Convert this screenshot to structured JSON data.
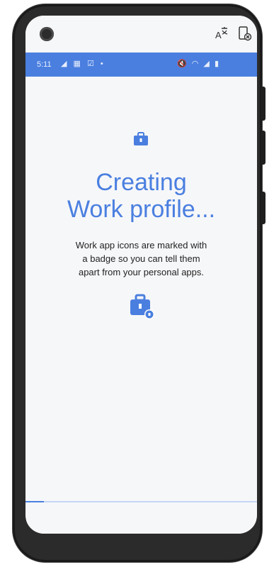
{
  "status_bar": {
    "time": "5:11",
    "left_icons": "◢ ▦ ☑ •",
    "right_icons": "🔇 ◠ ◢ ▮"
  },
  "device_top": {
    "translate_icon_glyph": "A",
    "app_icon_glyph": "▯"
  },
  "main": {
    "title_line1": "Creating",
    "title_line2": "Work profile...",
    "description_line1": "Work app icons are marked with",
    "description_line2": "a badge so you can tell them",
    "description_line3": "apart from your personal apps."
  },
  "progress": {
    "value": 0.08
  },
  "colors": {
    "accent": "#4a7fe0",
    "screen_bg": "#f6f7f9"
  },
  "icons": {
    "small_badge": "briefcase-icon",
    "large_badge": "briefcase-badge-icon",
    "camera": "front-camera-icon",
    "translate": "translate-icon",
    "app": "phone-app-icon"
  }
}
